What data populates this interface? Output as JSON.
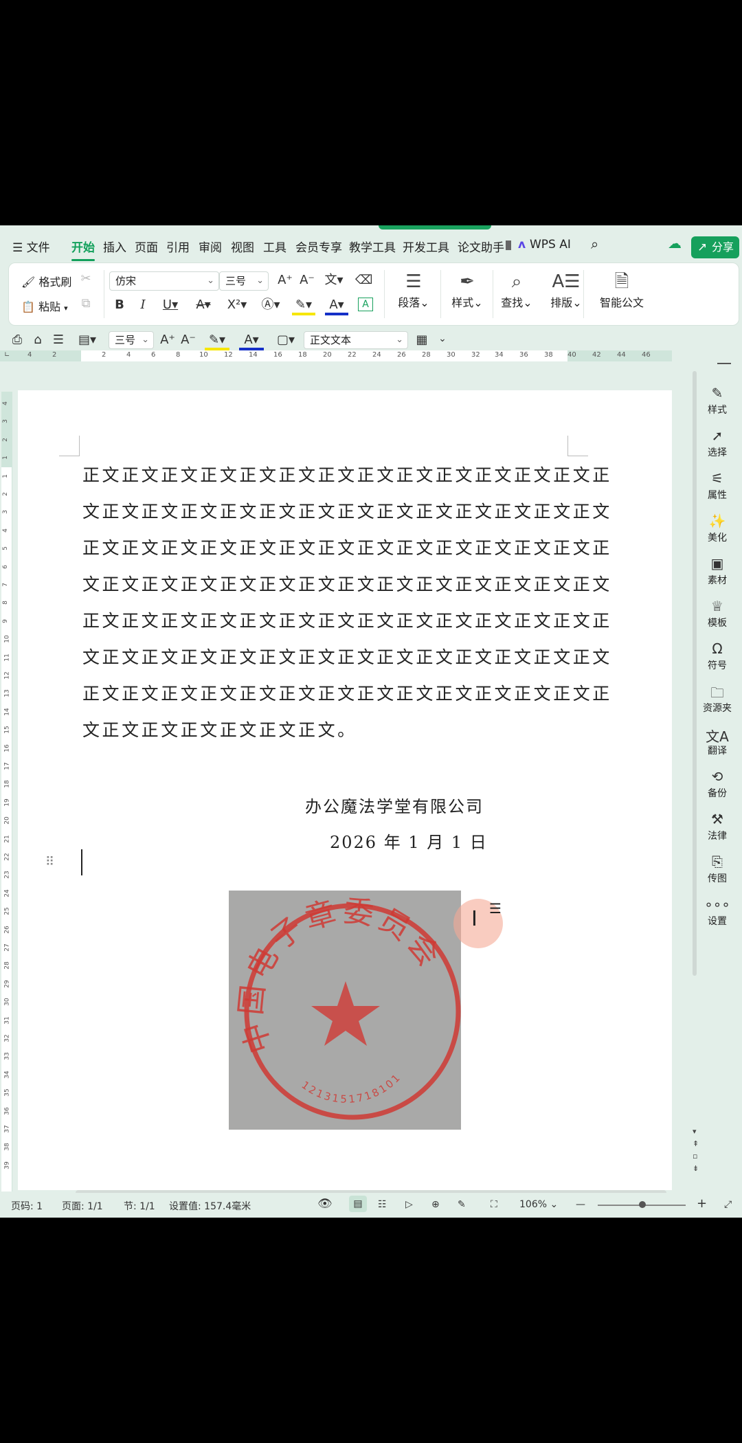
{
  "menubar": {
    "items": [
      "文件",
      "开始",
      "插入",
      "页面",
      "引用",
      "审阅",
      "视图",
      "工具",
      "会员专享",
      "教学工具",
      "开发工具",
      "论文助手",
      "WPS AI"
    ],
    "share": "分享"
  },
  "ribbon": {
    "format_painter": "格式刷",
    "paste": "粘贴",
    "font_name": "仿宋",
    "font_size": "三号",
    "paragraph": "段落",
    "styles": "样式",
    "find": "查找",
    "layout": "排版",
    "smart_doc": "智能公文"
  },
  "toolbar2": {
    "font_size": "三号",
    "style": "正文文本"
  },
  "ruler": {
    "h_ticks": [
      "4",
      "2",
      "2",
      "4",
      "6",
      "8",
      "10",
      "12",
      "14",
      "16",
      "18",
      "20",
      "22",
      "24",
      "26",
      "28",
      "30",
      "32",
      "34",
      "36",
      "38",
      "40",
      "42",
      "44",
      "46"
    ],
    "v_ticks": [
      "4",
      "3",
      "2",
      "1",
      "1",
      "2",
      "3",
      "4",
      "5",
      "6",
      "7",
      "8",
      "9",
      "10",
      "11",
      "12",
      "13",
      "14",
      "15",
      "16",
      "17",
      "18",
      "19",
      "20",
      "21",
      "22",
      "23",
      "24",
      "25",
      "26",
      "27",
      "28",
      "29",
      "30",
      "31",
      "32",
      "33",
      "34",
      "35",
      "36",
      "37",
      "38",
      "39"
    ]
  },
  "document": {
    "lines": [
      "正文正文正文正文正文正文正文正文正文正文正文正文正文正",
      "文正文正文正文正文正文正文正文正文正文正文正文正文正文",
      "正文正文正文正文正文正文正文正文正文正文正文正文正文正",
      "文正文正文正文正文正文正文正文正文正文正文正文正文正文",
      "正文正文正文正文正文正文正文正文正文正文正文正文正文正",
      "文正文正文正文正文正文正文正文正文正文正文正文正文正文",
      "正文正文正文正文正文正文正文正文正文正文正文正文正文正",
      "文正文正文正文正文正文正文。"
    ],
    "company": "办公魔法学堂有限公司",
    "date": "2026 年 1 月 1 日",
    "stamp": {
      "text": "中国电子章委员会",
      "number": "1213151718101",
      "color": "#d2332d"
    }
  },
  "right_panel": [
    "样式",
    "选择",
    "属性",
    "美化",
    "素材",
    "模板",
    "符号",
    "资源夹",
    "翻译",
    "备份",
    "法律",
    "传图",
    "设置"
  ],
  "status": {
    "page_num": "页码: 1",
    "pages": "页面: 1/1",
    "section": "节: 1/1",
    "setting": "设置值: 157.4毫米",
    "zoom": "106%"
  },
  "colors": {
    "accent": "#12a05b",
    "app_bg": "#e3efe9"
  }
}
